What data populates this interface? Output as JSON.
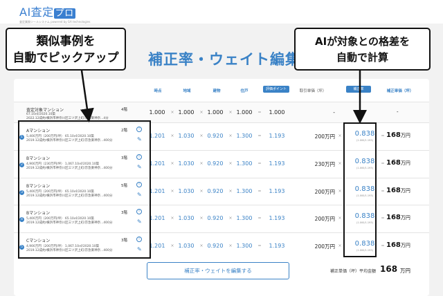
{
  "logo": {
    "main": "AI査定",
    "accent": "プロ",
    "sub": "査定業務ツールシステム",
    "sub2": "powered by GA technologies"
  },
  "page_title": "補正率・ウェイト編集",
  "headers": {
    "jiten": "時点",
    "chiiki": "地域",
    "tatemono": "建物",
    "sumu": "住戸",
    "hyouka": "評価ポイント",
    "torihiki": "取引単価（坪）",
    "hosei_ritsu": "補正率",
    "hosei_tanka": "補正単価（坪）"
  },
  "base_row": {
    "name": "査定対象マンション",
    "floor": "4階",
    "detail1": "67.10㎡/2020.10築",
    "detail2": "2022.12成約/横浜市神奈川区三ツ沢上町/京急東神奈...4分",
    "v": [
      "1.000",
      "1.000",
      "1.000",
      "1.000",
      "1.000"
    ],
    "price": "-",
    "adj": "-",
    "result": "-"
  },
  "rows": [
    {
      "num": "1",
      "name": "Aマンション",
      "floor": "2階",
      "detail1": "5,400万円（200万円/坪） 65.10㎡/2020.10築",
      "detail2": "2019.12成約/横浜市神奈川区三ツ沢上町/京急東神奈...400分",
      "v": [
        "1.201",
        "1.030",
        "0.920",
        "1.300",
        "1.193"
      ],
      "price": "200万円",
      "adj": "0.838",
      "adjsub": "(1.000/1.193)",
      "result": "168",
      "unit": "万円"
    },
    {
      "num": "2",
      "name": "Bマンション",
      "floor": "3階",
      "detail1": "4,900万円（230万円/坪） 1,067.10㎡/2020.10築",
      "detail2": "2019.12成約/横浜市神奈川区三ツ沢上町/京急東神奈...400分",
      "v": [
        "1.201",
        "1.030",
        "0.920",
        "1.300",
        "1.193"
      ],
      "price": "230万円",
      "adj": "0.838",
      "adjsub": "(1.000/1.193)",
      "result": "168",
      "unit": "万円"
    },
    {
      "num": "3",
      "name": "Bマンション",
      "floor": "5階",
      "detail1": "5,400万円（200万円/坪） 65.10㎡/2020.10築",
      "detail2": "2019.12成約/横浜市神奈川区三ツ沢上町/京急東神奈...400分",
      "v": [
        "1.201",
        "1.030",
        "0.920",
        "1.300",
        "1.193"
      ],
      "price": "200万円",
      "adj": "0.838",
      "adjsub": "(1.000/1.193)",
      "result": "168",
      "unit": "万円"
    },
    {
      "num": "4",
      "name": "Bマンション",
      "floor": "3階",
      "detail1": "5,400万円（200万円/坪） 65.10㎡/2020.10築",
      "detail2": "2019.12成約/横浜市神奈川区三ツ沢上町/京急東神奈...400分",
      "v": [
        "1.201",
        "1.030",
        "0.920",
        "1.300",
        "1.193"
      ],
      "price": "200万円",
      "adj": "0.838",
      "adjsub": "(1.000/1.193)",
      "result": "168",
      "unit": "万円"
    },
    {
      "num": "5",
      "name": "Cマンション",
      "floor": "3階",
      "detail1": "4,900万円（200万円/坪） 1,067.10㎡/2020.10築",
      "detail2": "2019.12成約/横浜市神奈川区三ツ沢上町/京急東神奈...400分",
      "v": [
        "1.201",
        "1.030",
        "0.920",
        "1.300",
        "1.193"
      ],
      "price": "200万円",
      "adj": "0.838",
      "adjsub": "(1.000/1.193)",
      "result": "168",
      "unit": "万円"
    }
  ],
  "ops": {
    "times": "×",
    "equals": "="
  },
  "icons": {
    "info": "info-icon",
    "edit": "pencil-icon"
  },
  "edit_button": "補正率・ウェイトを編集する",
  "average": {
    "label": "補正単価（坪）平均金額",
    "value": "168",
    "unit": "万円"
  },
  "callouts": {
    "left_1": "類似事例を",
    "left_2": "自動でピックアップ",
    "right_1": "AIが対象との格差を",
    "right_2": "自動で計算"
  },
  "colors": {
    "accent": "#3a82c6",
    "panel": "#ffffff",
    "background": "#f2f2f2"
  }
}
